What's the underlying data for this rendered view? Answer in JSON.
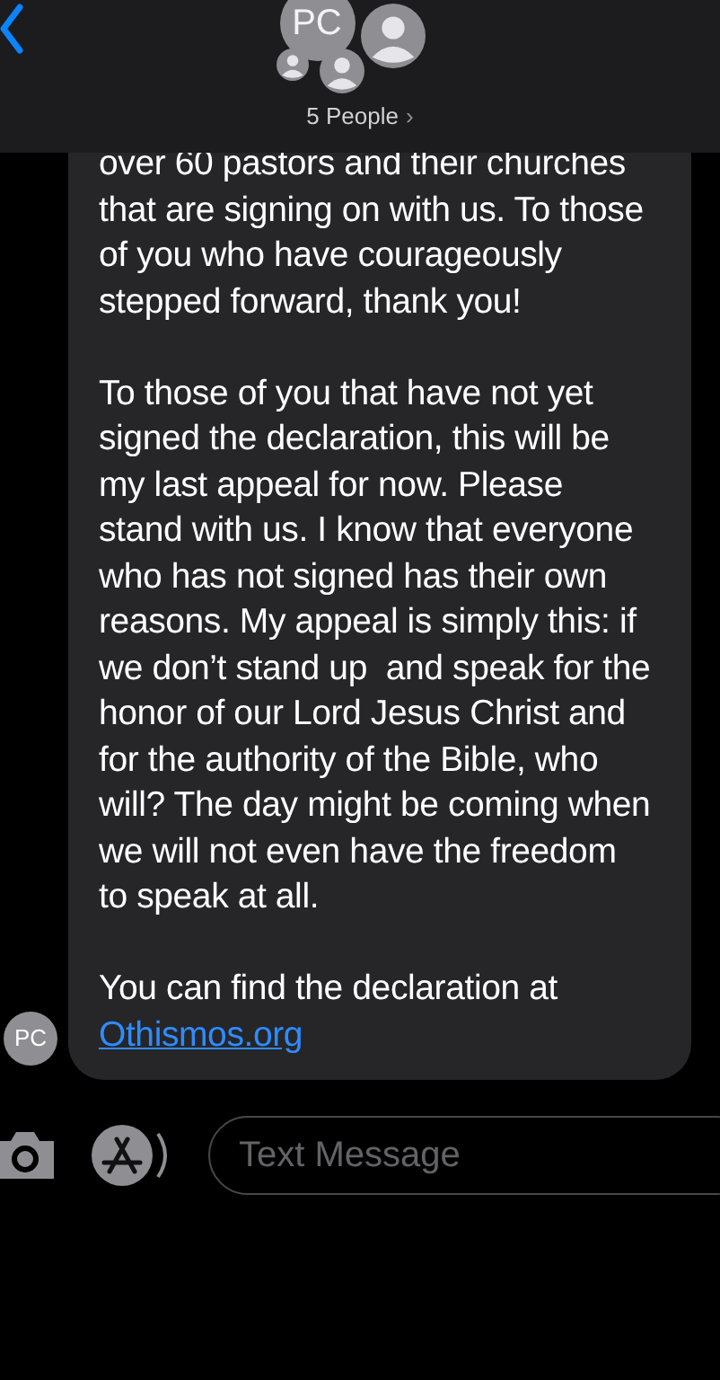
{
  "header": {
    "group_initials": "PC",
    "title": "5 People",
    "chevron": "›"
  },
  "message": {
    "paragraphs": [
      "over 60 pastors and their churches that are signing on with us. To those of you who have courageously stepped forward, thank you!",
      "To those of you that have not yet signed the declaration, this will be my last appeal for now. Please stand with us. I know that everyone who has not signed has their own reasons. My appeal is simply this: if we don’t stand up  and speak for the honor of our Lord Jesus Christ and for the authority of the Bible, who will? The day might be coming when we will not even have the freedom to speak at all."
    ],
    "closing": "You can find the declaration at",
    "link": "Othismos.org",
    "sender_initials": "PC"
  },
  "composer": {
    "placeholder": "Text Message"
  }
}
